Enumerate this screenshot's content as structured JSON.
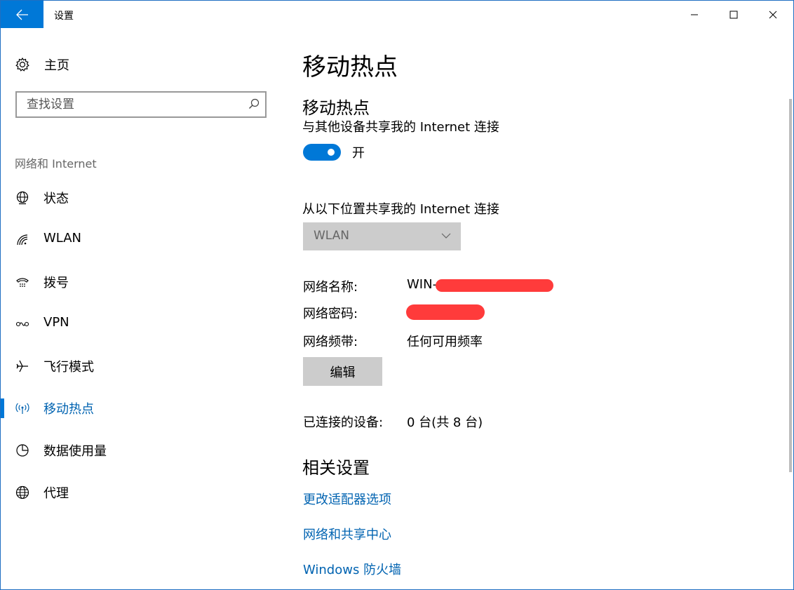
{
  "titlebar": {
    "title": "设置",
    "back_icon": "arrow-left-icon",
    "min_icon": "minimize-icon",
    "max_icon": "maximize-icon",
    "close_icon": "close-icon"
  },
  "sidebar": {
    "home_label": "主页",
    "search_placeholder": "查找设置",
    "section_label": "网络和 Internet",
    "items": [
      {
        "label": "状态",
        "icon": "globe-status-icon"
      },
      {
        "label": "WLAN",
        "icon": "wifi-icon"
      },
      {
        "label": "拨号",
        "icon": "dialup-icon"
      },
      {
        "label": "VPN",
        "icon": "vpn-icon"
      },
      {
        "label": "飞行模式",
        "icon": "airplane-icon"
      },
      {
        "label": "移动热点",
        "icon": "hotspot-icon",
        "active": true
      },
      {
        "label": "数据使用量",
        "icon": "data-usage-icon"
      },
      {
        "label": "代理",
        "icon": "globe-icon"
      }
    ]
  },
  "main": {
    "page_title": "移动热点",
    "hotspot_section_title": "移动热点",
    "share_desc": "与其他设备共享我的 Internet 连接",
    "toggle_label": "开",
    "source_label": "从以下位置共享我的 Internet 连接",
    "source_value": "WLAN",
    "network_name_label": "网络名称:",
    "network_name_value": "WIN-",
    "network_password_label": "网络密码:",
    "network_band_label": "网络频带:",
    "network_band_value": "任何可用频率",
    "edit_button": "编辑",
    "connected_label": "已连接的设备:",
    "connected_value": "0 台(共 8 台)",
    "related_title": "相关设置",
    "links": [
      "更改适配器选项",
      "网络和共享中心",
      "Windows 防火墙"
    ]
  },
  "colors": {
    "accent": "#0078d7",
    "link": "#0063b1",
    "redaction": "#ff3b3b"
  }
}
